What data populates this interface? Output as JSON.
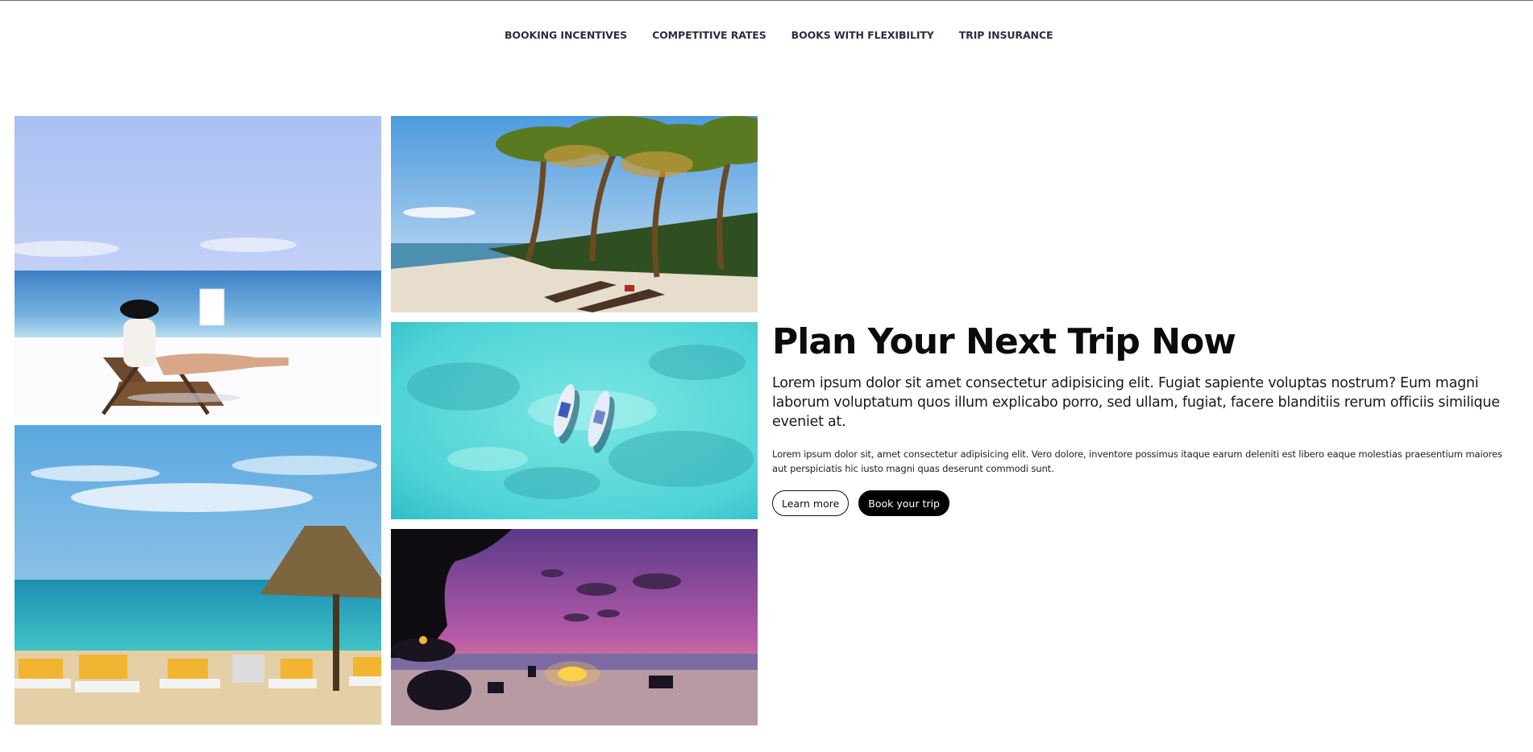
{
  "nav": {
    "items": [
      {
        "label": "BOOKING INCENTIVES"
      },
      {
        "label": "COMPETITIVE RATES"
      },
      {
        "label": "BOOKS WITH FLEXIBILITY"
      },
      {
        "label": "TRIP INSURANCE"
      }
    ]
  },
  "hero": {
    "title": "Plan Your Next Trip Now",
    "lead": "Lorem ipsum dolor sit amet consectetur adipisicing elit. Fugiat sapiente voluptas nostrum? Eum magni laborum voluptatum quos illum explicabo porro, sed ullam, fugiat, facere blanditiis rerum officiis similique eveniet at.",
    "body": "Lorem ipsum dolor sit, amet consectetur adipisicing elit. Vero dolore, inventore possimus itaque earum deleniti est libero eaque molestias praesentium maiores aut perspiciatis hic iusto magni quas deserunt commodi sunt.",
    "buttons": {
      "learn_more": "Learn more",
      "book_trip": "Book your trip"
    }
  },
  "colors": {
    "nav_text": "#2b3040",
    "title": "#0b0b0b",
    "button_solid_bg": "#000000",
    "button_solid_text": "#ffffff"
  }
}
